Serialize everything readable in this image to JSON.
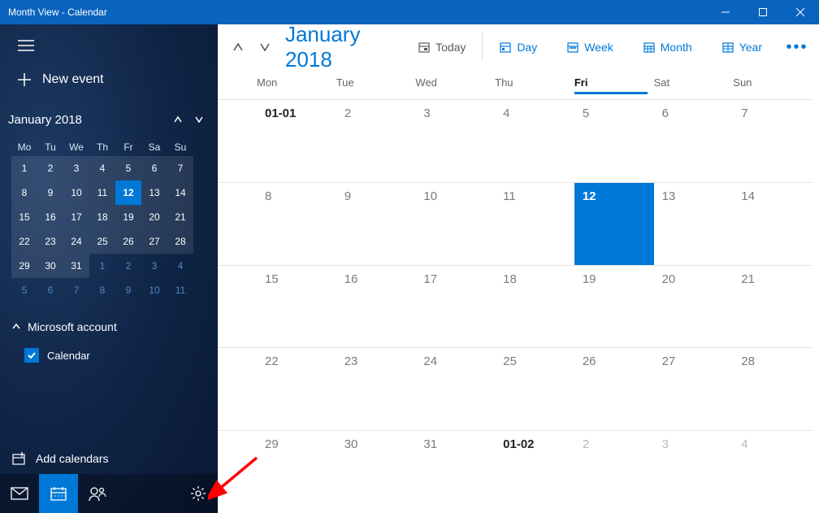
{
  "window": {
    "title": "Month View - Calendar"
  },
  "sidebar": {
    "new_event": "New event",
    "mini_month": "January 2018",
    "dow": [
      "Mo",
      "Tu",
      "We",
      "Th",
      "Fr",
      "Sa",
      "Su"
    ],
    "mini_days": [
      {
        "n": "1",
        "cur": true
      },
      {
        "n": "2",
        "cur": true
      },
      {
        "n": "3",
        "cur": true
      },
      {
        "n": "4",
        "cur": true
      },
      {
        "n": "5",
        "cur": true
      },
      {
        "n": "6",
        "cur": true
      },
      {
        "n": "7",
        "cur": true
      },
      {
        "n": "8",
        "cur": true
      },
      {
        "n": "9",
        "cur": true
      },
      {
        "n": "10",
        "cur": true
      },
      {
        "n": "11",
        "cur": true
      },
      {
        "n": "12",
        "cur": true,
        "sel": true
      },
      {
        "n": "13",
        "cur": true
      },
      {
        "n": "14",
        "cur": true
      },
      {
        "n": "15",
        "cur": true
      },
      {
        "n": "16",
        "cur": true
      },
      {
        "n": "17",
        "cur": true
      },
      {
        "n": "18",
        "cur": true
      },
      {
        "n": "19",
        "cur": true
      },
      {
        "n": "20",
        "cur": true
      },
      {
        "n": "21",
        "cur": true
      },
      {
        "n": "22",
        "cur": true
      },
      {
        "n": "23",
        "cur": true
      },
      {
        "n": "24",
        "cur": true
      },
      {
        "n": "25",
        "cur": true
      },
      {
        "n": "26",
        "cur": true
      },
      {
        "n": "27",
        "cur": true
      },
      {
        "n": "28",
        "cur": true
      },
      {
        "n": "29",
        "cur": true
      },
      {
        "n": "30",
        "cur": true
      },
      {
        "n": "31",
        "cur": true
      },
      {
        "n": "1"
      },
      {
        "n": "2"
      },
      {
        "n": "3"
      },
      {
        "n": "4"
      },
      {
        "n": "5"
      },
      {
        "n": "6"
      },
      {
        "n": "7"
      },
      {
        "n": "8"
      },
      {
        "n": "9"
      },
      {
        "n": "10"
      },
      {
        "n": "11"
      }
    ],
    "account_label": "Microsoft account",
    "calendar_label": "Calendar",
    "add_label": "Add calendars"
  },
  "toolbar": {
    "title": "January 2018",
    "today": "Today",
    "day": "Day",
    "week": "Week",
    "month": "Month",
    "year": "Year"
  },
  "main": {
    "dow": [
      "Mon",
      "Tue",
      "Wed",
      "Thu",
      "Fri",
      "Sat",
      "Sun"
    ],
    "today_col": 4,
    "weeks": [
      [
        {
          "t": "01-01",
          "bold": true
        },
        {
          "t": "2"
        },
        {
          "t": "3"
        },
        {
          "t": "4"
        },
        {
          "t": "5"
        },
        {
          "t": "6"
        },
        {
          "t": "7"
        }
      ],
      [
        {
          "t": "8"
        },
        {
          "t": "9"
        },
        {
          "t": "10"
        },
        {
          "t": "11"
        },
        {
          "t": "12",
          "sel": true
        },
        {
          "t": "13"
        },
        {
          "t": "14"
        }
      ],
      [
        {
          "t": "15"
        },
        {
          "t": "16"
        },
        {
          "t": "17"
        },
        {
          "t": "18"
        },
        {
          "t": "19"
        },
        {
          "t": "20"
        },
        {
          "t": "21"
        }
      ],
      [
        {
          "t": "22"
        },
        {
          "t": "23"
        },
        {
          "t": "24"
        },
        {
          "t": "25"
        },
        {
          "t": "26"
        },
        {
          "t": "27"
        },
        {
          "t": "28"
        }
      ],
      [
        {
          "t": "29"
        },
        {
          "t": "30"
        },
        {
          "t": "31"
        },
        {
          "t": "01-02",
          "bold": true,
          "dim": false
        },
        {
          "t": "2",
          "dim": true
        },
        {
          "t": "3",
          "dim": true
        },
        {
          "t": "4",
          "dim": true
        }
      ]
    ]
  }
}
